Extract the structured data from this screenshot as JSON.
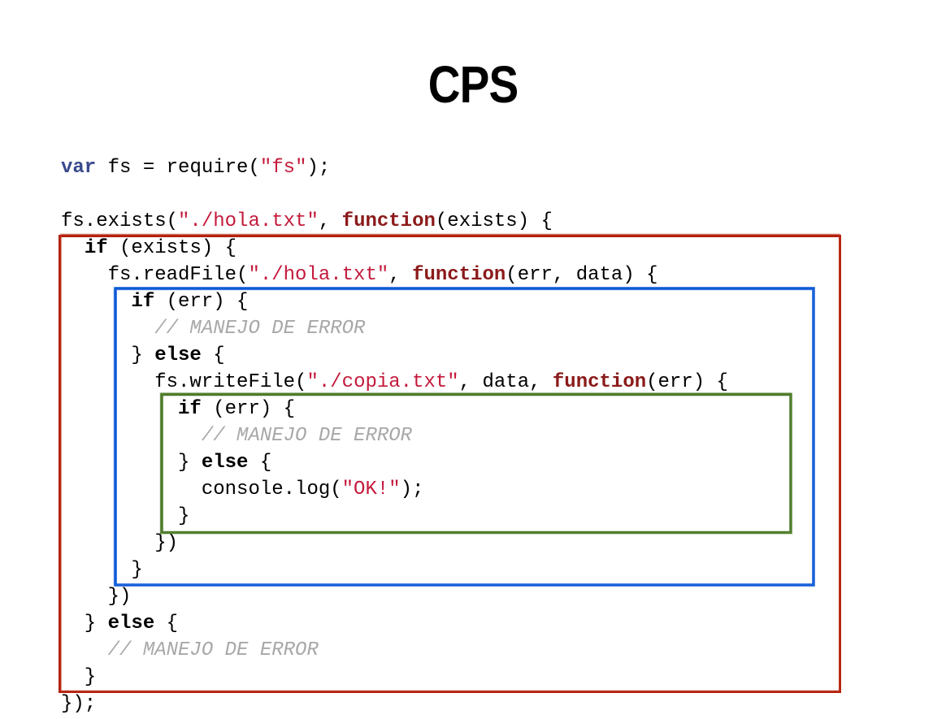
{
  "title": "CPS",
  "colors": {
    "keyword_var": "#3a4a8c",
    "keyword_function": "#8b1a1a",
    "string": "#c41a3c",
    "comment": "#a8a8a8",
    "box_outer": "#b3200f",
    "box_middle": "#0a58d6",
    "box_inner": "#4d7a2a"
  },
  "code": {
    "lines": [
      [
        {
          "t": "var",
          "c": "kw"
        },
        {
          "t": " fs = require("
        },
        {
          "t": "\"fs\"",
          "c": "str"
        },
        {
          "t": ");"
        }
      ],
      [],
      [
        {
          "t": "fs.exists("
        },
        {
          "t": "\"./hola.txt\"",
          "c": "str"
        },
        {
          "t": ", "
        },
        {
          "t": "function",
          "c": "fn"
        },
        {
          "t": "(exists) {"
        }
      ],
      [
        {
          "t": "  "
        },
        {
          "t": "if",
          "c": "b"
        },
        {
          "t": " (exists) {"
        }
      ],
      [
        {
          "t": "    fs.readFile("
        },
        {
          "t": "\"./hola.txt\"",
          "c": "str"
        },
        {
          "t": ", "
        },
        {
          "t": "function",
          "c": "fn"
        },
        {
          "t": "(err, data) {"
        }
      ],
      [
        {
          "t": "      "
        },
        {
          "t": "if",
          "c": "b"
        },
        {
          "t": " (err) {"
        }
      ],
      [
        {
          "t": "        "
        },
        {
          "t": "// MANEJO DE ERROR",
          "c": "com"
        }
      ],
      [
        {
          "t": "      } "
        },
        {
          "t": "else",
          "c": "b"
        },
        {
          "t": " {"
        }
      ],
      [
        {
          "t": "        fs.writeFile("
        },
        {
          "t": "\"./copia.txt\"",
          "c": "str"
        },
        {
          "t": ", data, "
        },
        {
          "t": "function",
          "c": "fn"
        },
        {
          "t": "(err) {"
        }
      ],
      [
        {
          "t": "          "
        },
        {
          "t": "if",
          "c": "b"
        },
        {
          "t": " (err) {"
        }
      ],
      [
        {
          "t": "            "
        },
        {
          "t": "// MANEJO DE ERROR",
          "c": "com"
        }
      ],
      [
        {
          "t": "          } "
        },
        {
          "t": "else",
          "c": "b"
        },
        {
          "t": " {"
        }
      ],
      [
        {
          "t": "            console.log("
        },
        {
          "t": "\"OK!\"",
          "c": "str"
        },
        {
          "t": ");"
        }
      ],
      [
        {
          "t": "          }"
        }
      ],
      [
        {
          "t": "        })"
        }
      ],
      [
        {
          "t": "      }"
        }
      ],
      [
        {
          "t": "    })"
        }
      ],
      [
        {
          "t": "  } "
        },
        {
          "t": "else",
          "c": "b"
        },
        {
          "t": " {"
        }
      ],
      [
        {
          "t": "    "
        },
        {
          "t": "// MANEJO DE ERROR",
          "c": "com"
        }
      ],
      [
        {
          "t": "  }"
        }
      ],
      [
        {
          "t": "});"
        }
      ]
    ]
  }
}
